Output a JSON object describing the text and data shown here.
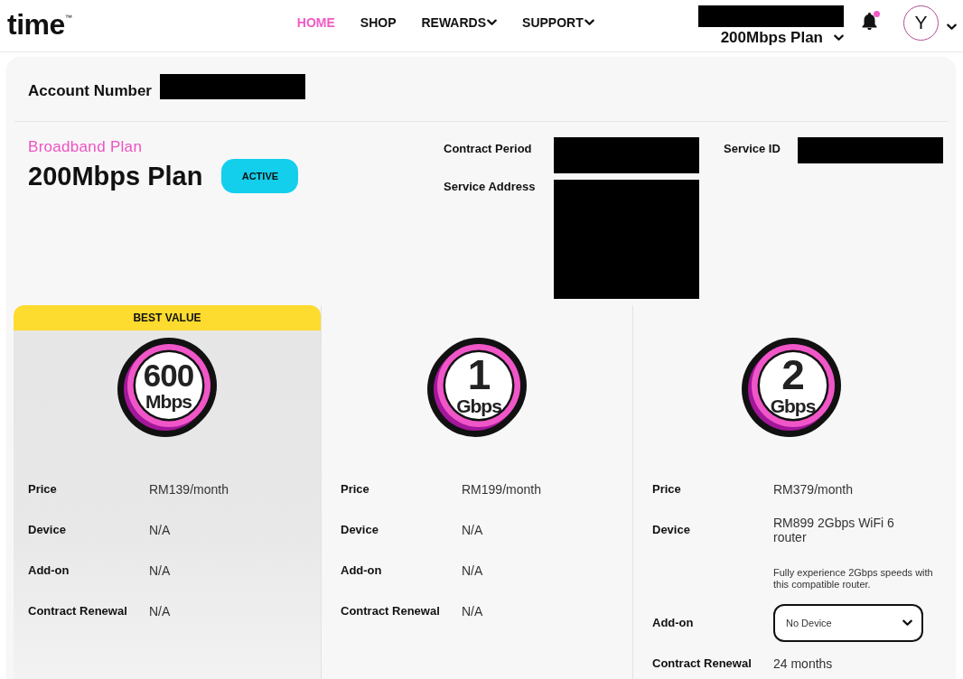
{
  "header": {
    "logo": "time$^{™}$",
    "nav": [
      {
        "label": "HOME",
        "selected": true,
        "dropdown": false
      },
      {
        "label": "SHOP",
        "selected": false,
        "dropdown": false
      },
      {
        "label": "REWARDS",
        "selected": false,
        "dropdown": true
      },
      {
        "label": "SUPPORT",
        "selected": false,
        "dropdown": true
      }
    ],
    "plan_switcher": {
      "redacted": true,
      "label": "200Mbps Plan"
    },
    "notifications": {
      "unread": true
    },
    "avatar": {
      "initial": "Y"
    }
  },
  "account": {
    "label": "Account Number",
    "redacted": true
  },
  "plan": {
    "category": "Broadband Plan",
    "name": "200Mbps Plan",
    "status": "ACTIVE",
    "details": [
      {
        "label": "Contract Period",
        "redacted": true
      },
      {
        "label": "Service Address",
        "redacted": true
      },
      {
        "label": "Service ID",
        "redacted": true
      }
    ]
  },
  "offers": [
    {
      "ribbon": "BEST VALUE",
      "highlighted": true,
      "speed": "600",
      "unit": "Mbps",
      "rows": [
        {
          "kind": "text",
          "label": "Price",
          "value": "RM139/month"
        },
        {
          "kind": "text",
          "label": "Device",
          "value": "N/A"
        },
        {
          "kind": "text",
          "label": "Add-on",
          "value": "N/A"
        },
        {
          "kind": "text",
          "label": "Contract Renewal",
          "value": "N/A"
        }
      ]
    },
    {
      "highlighted": false,
      "speed": "1",
      "unit": "Gbps",
      "rows": [
        {
          "kind": "text",
          "label": "Price",
          "value": "RM199/month"
        },
        {
          "kind": "text",
          "label": "Device",
          "value": "N/A"
        },
        {
          "kind": "text",
          "label": "Add-on",
          "value": "N/A"
        },
        {
          "kind": "text",
          "label": "Contract Renewal",
          "value": "N/A"
        }
      ]
    },
    {
      "highlighted": false,
      "speed": "2",
      "unit": "Gbps",
      "rows": [
        {
          "kind": "text",
          "label": "Price",
          "value": "RM379/month"
        },
        {
          "kind": "text",
          "label": "Device",
          "value": "RM899 2Gbps WiFi 6 router",
          "note": "Fully experience 2Gbps speeds with this compatible router."
        },
        {
          "kind": "select",
          "label": "Add-on",
          "value": "No Device"
        },
        {
          "kind": "text",
          "label": "Contract Renewal",
          "value": "24 months"
        }
      ]
    }
  ]
}
